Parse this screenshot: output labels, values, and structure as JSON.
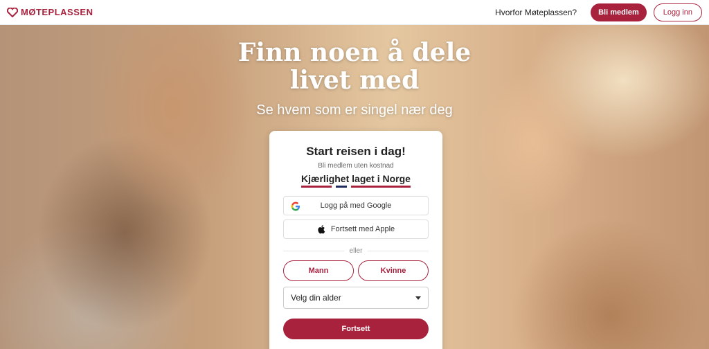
{
  "header": {
    "brand": "MØTEPLASSEN",
    "why_link": "Hvorfor Møteplassen?",
    "join_label": "Bli medlem",
    "login_label": "Logg inn"
  },
  "hero": {
    "title_line1": "Finn noen å dele",
    "title_line2": "livet med",
    "subtitle": "Se hvem som er singel nær deg"
  },
  "card": {
    "title": "Start reisen i dag!",
    "subtitle": "Bli medlem uten kostnad",
    "tagline": "Kjærlighet laget i Norge",
    "google_label": "Logg på med Google",
    "apple_label": "Fortsett med Apple",
    "divider": "eller",
    "male_label": "Mann",
    "female_label": "Kvinne",
    "age_select": "Velg din alder",
    "continue_label": "Fortsett"
  },
  "colors": {
    "brand": "#a8213d",
    "flag_blue": "#1e2a5e"
  }
}
